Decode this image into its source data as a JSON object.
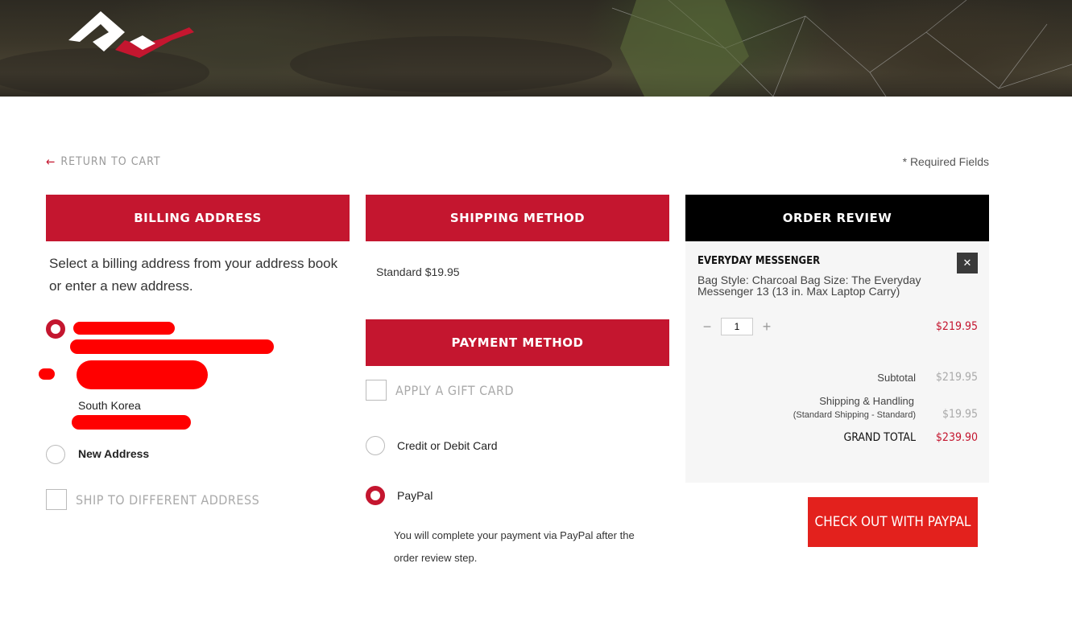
{
  "header": {
    "logo_icon": "peak-design-logo-icon"
  },
  "nav": {
    "return_label": "RETURN TO CART",
    "required_label": "* Required Fields"
  },
  "billing": {
    "title": "BILLING ADDRESS",
    "intro": "Select a billing address from your address book or enter a new address.",
    "saved_address_country": "South Korea",
    "new_address_label": "New Address",
    "ship_different_label": "SHIP TO DIFFERENT ADDRESS"
  },
  "shipping": {
    "title": "SHIPPING METHOD",
    "option": "Standard $19.95"
  },
  "payment": {
    "title": "PAYMENT METHOD",
    "gift_card_label": "APPLY A GIFT CARD",
    "options": [
      "Credit or Debit Card",
      "PayPal"
    ],
    "selected": "PayPal",
    "paypal_note": "You will complete your payment via PayPal after the order review step."
  },
  "review": {
    "title": "ORDER REVIEW",
    "item_name": "EVERYDAY MESSENGER",
    "item_desc": "Bag Style: Charcoal Bag Size: The Everyday Messenger 13 (13 in. Max Laptop Carry)",
    "quantity": "1",
    "item_price": "$219.95",
    "subtotal_label": "Subtotal",
    "subtotal_value": "$219.95",
    "shipping_label": "Shipping & Handling",
    "shipping_sub": "(Standard Shipping - Standard)",
    "shipping_value": "$19.95",
    "grand_total_label": "GRAND TOTAL",
    "grand_total_value": "$239.90",
    "checkout_button": "CHECK OUT WITH PAYPAL"
  },
  "colors": {
    "accent": "#c4162f",
    "paypal_button": "#e3211d",
    "review_header": "#000000"
  }
}
